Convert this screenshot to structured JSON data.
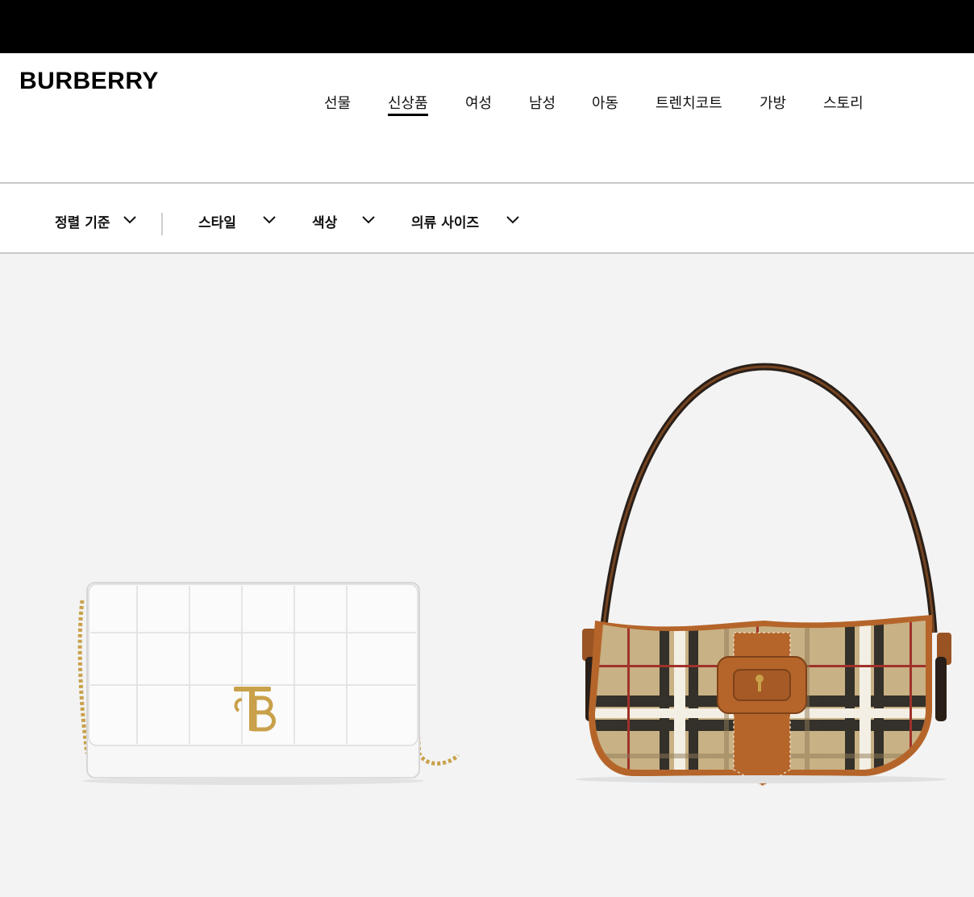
{
  "brand": {
    "logo": "BURBERRY"
  },
  "nav": {
    "items": [
      {
        "label": "선물"
      },
      {
        "label": "신상품"
      },
      {
        "label": "여성"
      },
      {
        "label": "남성"
      },
      {
        "label": "아동"
      },
      {
        "label": "트렌치코트"
      },
      {
        "label": "가방"
      },
      {
        "label": "스토리"
      }
    ],
    "active": "신상품"
  },
  "filters": {
    "sort": "정렬 기준",
    "style": "스타일",
    "color": "색상",
    "size": "의류 사이즈"
  },
  "products": [
    {
      "image": "white-quilted-leather-chain-bag-with-gold-tb-monogram"
    },
    {
      "image": "check-canvas-shoulder-bag-with-tan-leather-buckle"
    }
  ],
  "colors": {
    "topbar": "#000000",
    "grid_background": "#f3f3f3",
    "divider": "#c9c9c9",
    "gold": "#c9a14a",
    "tan": "#b5652a",
    "check_beige": "#c8b184"
  }
}
